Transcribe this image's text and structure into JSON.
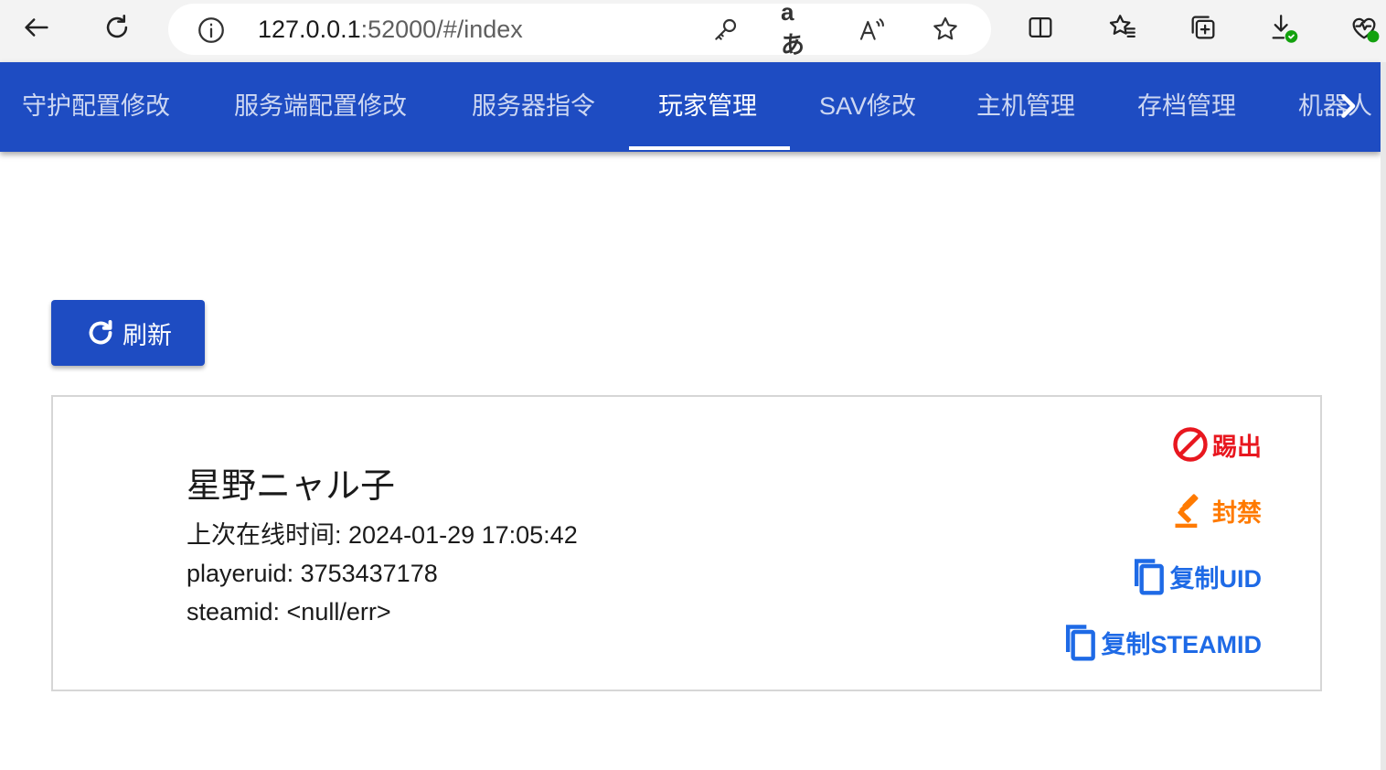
{
  "browser": {
    "url_host": "127.0.0.1",
    "url_rest": ":52000/#/index",
    "read_aloud_label": "aあ"
  },
  "nav": {
    "tabs": [
      {
        "label": "守护配置修改"
      },
      {
        "label": "服务端配置修改"
      },
      {
        "label": "服务器指令"
      },
      {
        "label": "玩家管理"
      },
      {
        "label": "SAV修改"
      },
      {
        "label": "主机管理"
      },
      {
        "label": "存档管理"
      },
      {
        "label": "机器人"
      }
    ],
    "active_tab": "玩家管理"
  },
  "refresh": {
    "label": "刷新",
    "icon": "refresh-icon"
  },
  "player": {
    "name": "星野ニャル子",
    "last_online": "上次在线时间: 2024-01-29 17:05:42",
    "playeruid": "playeruid: 3753437178",
    "steamid": "steamid: <null/err>"
  },
  "actions": {
    "kick": "踢出",
    "ban": "封禁",
    "copy_uid": "复制UID",
    "copy_steamid": "复制STEAMID"
  },
  "colors": {
    "primary": "#1e4cc2",
    "kick": "#e8171f",
    "ban": "#ff7a00",
    "copy": "#1e6ae6"
  }
}
